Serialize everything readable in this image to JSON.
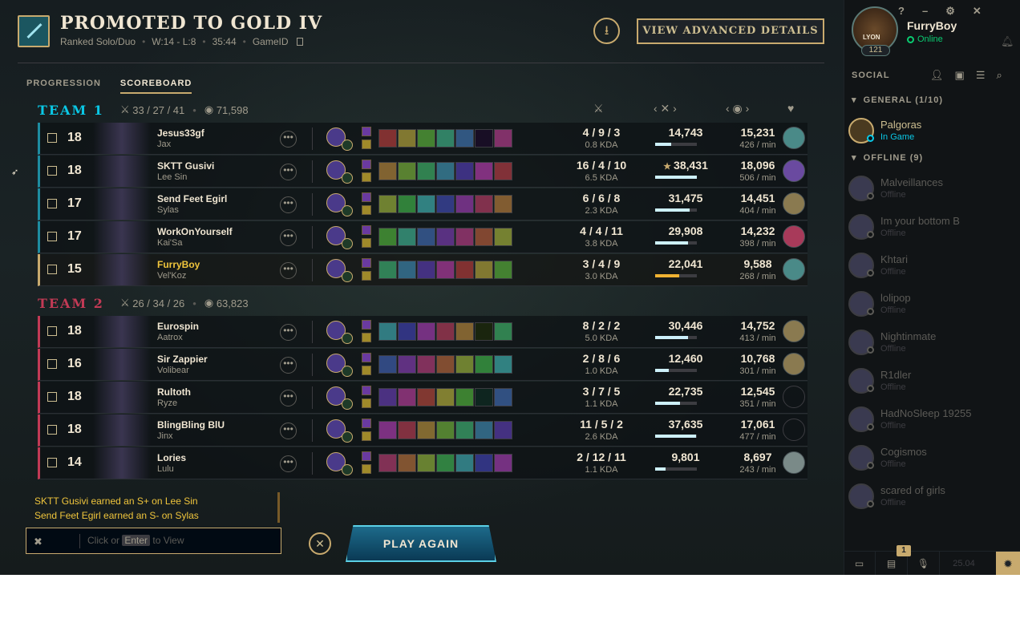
{
  "header": {
    "title": "PROMOTED TO GOLD IV",
    "queue": "Ranked Solo/Duo",
    "record": "W:14 - L:8",
    "duration": "35:44",
    "gameid_label": "GameID",
    "advanced_label": "VIEW ADVANCED DETAILS"
  },
  "tabs": [
    {
      "label": "PROGRESSION",
      "active": false
    },
    {
      "label": "SCOREBOARD",
      "active": true
    }
  ],
  "teams": [
    {
      "name": "TEAM 1",
      "color": "#0ac8e6",
      "kda": "33 / 27 / 41",
      "gold": "71,598",
      "players": [
        {
          "level": "18",
          "name": "Jesus33gf",
          "champion": "Jax",
          "kda": "4 / 9 / 3",
          "kda_ratio": "0.8 KDA",
          "damage": "14,743",
          "damage_frac": 0.38,
          "gold": "15,231",
          "gpm": "426 / min",
          "rank": "plat",
          "mvp": false,
          "me": false
        },
        {
          "level": "18",
          "name": "SKTT Gusivi",
          "champion": "Lee Sin",
          "kda": "16 / 4 / 10",
          "kda_ratio": "6.5 KDA",
          "damage": "38,431",
          "damage_frac": 1.0,
          "gold": "18,096",
          "gpm": "506 / min",
          "rank": "purple",
          "mvp": true,
          "me": false
        },
        {
          "level": "17",
          "name": "Send Feet Egirl",
          "champion": "Sylas",
          "kda": "6 / 6 / 8",
          "kda_ratio": "2.3 KDA",
          "damage": "31,475",
          "damage_frac": 0.82,
          "gold": "14,451",
          "gpm": "404 / min",
          "rank": "gold",
          "mvp": false,
          "me": false
        },
        {
          "level": "17",
          "name": "WorkOnYourself",
          "champion": "Kai'Sa",
          "kda": "4 / 4 / 11",
          "kda_ratio": "3.8 KDA",
          "damage": "29,908",
          "damage_frac": 0.78,
          "gold": "14,232",
          "gpm": "398 / min",
          "rank": "pink",
          "mvp": false,
          "me": false
        },
        {
          "level": "15",
          "name": "FurryBoy",
          "champion": "Vel'Koz",
          "kda": "3 / 4 / 9",
          "kda_ratio": "3.0 KDA",
          "damage": "22,041",
          "damage_frac": 0.57,
          "gold": "9,588",
          "gpm": "268 / min",
          "rank": "plat",
          "mvp": false,
          "me": true
        }
      ]
    },
    {
      "name": "TEAM 2",
      "color": "#c23a55",
      "kda": "26 / 34 / 26",
      "gold": "63,823",
      "players": [
        {
          "level": "18",
          "name": "Eurospin",
          "champion": "Aatrox",
          "kda": "8 / 2 / 2",
          "kda_ratio": "5.0 KDA",
          "damage": "30,446",
          "damage_frac": 0.79,
          "gold": "14,752",
          "gpm": "413 / min",
          "rank": "gold",
          "mvp": false,
          "me": false
        },
        {
          "level": "16",
          "name": "Sir Zappier",
          "champion": "Volibear",
          "kda": "2 / 8 / 6",
          "kda_ratio": "1.0 KDA",
          "damage": "12,460",
          "damage_frac": 0.32,
          "gold": "10,768",
          "gpm": "301 / min",
          "rank": "gold",
          "mvp": false,
          "me": false
        },
        {
          "level": "18",
          "name": "Rultoth",
          "champion": "Ryze",
          "kda": "3 / 7 / 5",
          "kda_ratio": "1.1 KDA",
          "damage": "22,735",
          "damage_frac": 0.59,
          "gold": "12,545",
          "gpm": "351 / min",
          "rank": "none",
          "mvp": false,
          "me": false
        },
        {
          "level": "18",
          "name": "BlingBling BlU",
          "champion": "Jinx",
          "kda": "11 / 5 / 2",
          "kda_ratio": "2.6 KDA",
          "damage": "37,635",
          "damage_frac": 0.98,
          "gold": "17,061",
          "gpm": "477 / min",
          "rank": "none",
          "mvp": false,
          "me": false
        },
        {
          "level": "14",
          "name": "Lories",
          "champion": "Lulu",
          "kda": "2 / 12 / 11",
          "kda_ratio": "1.1 KDA",
          "damage": "9,801",
          "damage_frac": 0.25,
          "gold": "8,697",
          "gpm": "243 / min",
          "rank": "silver",
          "mvp": false,
          "me": false
        }
      ]
    }
  ],
  "chat": {
    "messages": [
      "SKTT Gusivi earned an S+ on Lee Sin",
      "Send Feet Egirl earned an S- on Sylas"
    ],
    "placeholder_pre": "Click or",
    "placeholder_key": "Enter",
    "placeholder_post": "to View"
  },
  "play_again_label": "PLAY AGAIN",
  "social": {
    "me": {
      "name": "FurryBoy",
      "status": "Online",
      "level": "121",
      "title": "LYON"
    },
    "title": "SOCIAL",
    "groups": [
      {
        "label": "GENERAL (1/10)",
        "friends": [
          {
            "name": "Palgoras",
            "status": "In Game",
            "ingame": true
          }
        ]
      },
      {
        "label": "OFFLINE (9)",
        "friends": [
          {
            "name": "Malveillances",
            "status": "Offline",
            "ingame": false
          },
          {
            "name": "Im your bottom B",
            "status": "Offline",
            "ingame": false
          },
          {
            "name": "Khtari",
            "status": "Offline",
            "ingame": false
          },
          {
            "name": "lolipop",
            "status": "Offline",
            "ingame": false
          },
          {
            "name": "Nightinmate",
            "status": "Offline",
            "ingame": false
          },
          {
            "name": "R1dler",
            "status": "Offline",
            "ingame": false
          },
          {
            "name": "HadNoSleep 19255",
            "status": "Offline",
            "ingame": false
          },
          {
            "name": "Cogismos",
            "status": "Offline",
            "ingame": false
          },
          {
            "name": "scared of girls",
            "status": "Offline",
            "ingame": false
          }
        ]
      }
    ],
    "notification_count": "1",
    "version": "25.04"
  },
  "colors": {
    "gold": "#c8aa6e",
    "team1": "#0ac8e6",
    "team2": "#c23a55",
    "online": "#0acb71"
  }
}
